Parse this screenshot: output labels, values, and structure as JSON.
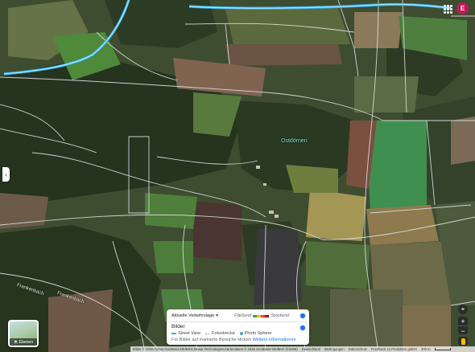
{
  "map": {
    "place_label": "Ostdörnen",
    "road_labels": [
      "Frankenbach",
      "Frankenbach"
    ]
  },
  "header": {
    "avatar_letter": "E",
    "apps_icon": "apps-grid-icon"
  },
  "left_panel": {
    "collapse_glyph": "‹"
  },
  "layers": {
    "label": "Ebenen",
    "icon": "layers-icon"
  },
  "legend": {
    "traffic_dropdown_label": "Aktuelle Verkehrslage",
    "traffic_fast_label": "Fließend",
    "traffic_slow_label": "Stockend",
    "traffic_colors": [
      "#34a853",
      "#fbbc04",
      "#ea4335",
      "#a50e0e"
    ],
    "images_title": "Bilder",
    "item_street_view": "Street View",
    "item_photo_path": "Fotostrecke",
    "item_photo_sphere": "Photo Sphere",
    "info_text": "Für Bilder auf markierte Bereiche klicken",
    "info_link": "Weitere Informationen"
  },
  "controls": {
    "locate_icon": "my-location-icon",
    "zoom_in": "+",
    "zoom_out": "−",
    "pegman_icon": "pegman-icon"
  },
  "attribution": {
    "imagery": "Bilder © 2025 Airbus,GeoBasis-DE/BKG,Maxar Technologies,Kartendaten © 2025 GeoBasis-DE/BKG (©2009)",
    "country": "Deutschland",
    "terms": "Bedingungen",
    "privacy": "Datenschutz",
    "feedback": "Feedback zu Produkten geben",
    "scale": "200 m"
  },
  "colors": {
    "route": "#4fc3f7",
    "place_label": "#7fe0d8",
    "accent_blue": "#1a73e8",
    "avatar": "#c2185b"
  }
}
